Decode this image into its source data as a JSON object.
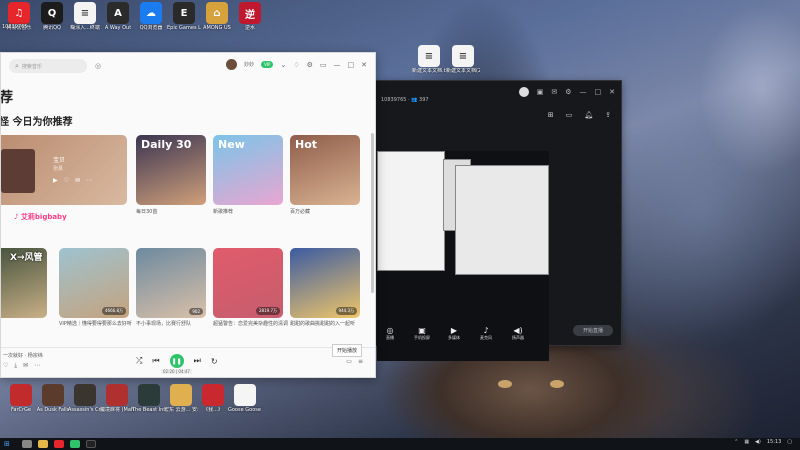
{
  "desktop": {
    "top_icons": [
      {
        "name": "netease-music",
        "label": "网易云音乐",
        "color": "#e6262a",
        "glyph": "♫"
      },
      {
        "name": "qq",
        "label": "腾讯QQ",
        "color": "#1c1c1c",
        "glyph": "Q"
      },
      {
        "name": "doc",
        "label": "糊涂入...终端",
        "color": "#f4f4f4",
        "glyph": "≡"
      },
      {
        "name": "a-way-out",
        "label": "A Way Out",
        "color": "#2b2b2b",
        "glyph": "A"
      },
      {
        "name": "qq-browser",
        "label": "QQ浏览器",
        "color": "#1b7cf0",
        "glyph": "☁"
      },
      {
        "name": "epic",
        "label": "Epic Games Launcher",
        "color": "#2a2a2a",
        "glyph": "E"
      },
      {
        "name": "among-us",
        "label": "AMONG US",
        "color": "#d6a23c",
        "glyph": "⌂"
      },
      {
        "name": "game-nz",
        "label": "逆水",
        "color": "#c0182e",
        "glyph": "逆"
      }
    ],
    "top_left_badge": "10839765",
    "file_icons": [
      {
        "label": "新建文本文档.txt"
      },
      {
        "label": "新建文本文档(2).txt"
      }
    ],
    "bottom_icons": [
      {
        "label": "FarCrGe",
        "color": "#c22b2b"
      },
      {
        "label": "As Dusk Falls",
        "color": "#5a3b2c"
      },
      {
        "label": "Assassin's Creed S...",
        "color": "#3b3530"
      },
      {
        "label": "魔境麻将 (Mahjong...",
        "color": "#b03030"
      },
      {
        "label": "The Beast Inside",
        "color": "#2a3b3a"
      },
      {
        "label": "宏东 云游... 安卓游戏...",
        "color": "#e0b050"
      },
      {
        "label": "《我...》",
        "color": "#c8282e"
      },
      {
        "label": "Goose Goose Duck",
        "color": "#f5f5f5"
      }
    ]
  },
  "music_window": {
    "search_placeholder": "搜索音乐",
    "username": "妙妙",
    "vip_label": "VIP",
    "heading": "荐",
    "subheading": "怪 今日为你推荐",
    "row1_cards": [
      {
        "caption": "",
        "title": "宝贝",
        "subtitle": "张悬",
        "bg": "linear-gradient(135deg,#b98a6e,#d8b9a0)"
      },
      {
        "caption": "每日30首",
        "big": "Daily 30",
        "bg": "linear-gradient(160deg,#3b3552,#d0a07a)"
      },
      {
        "caption": "新歌推荐",
        "big": "New",
        "bg": "linear-gradient(160deg,#7cc4e8,#e8a6d1)"
      },
      {
        "caption": "百万必藏",
        "big": "Hot",
        "bg": "linear-gradient(160deg,#8f5d4a,#d9b392)"
      }
    ],
    "row2_cards": [
      {
        "caption": "",
        "plays": "",
        "bg": "linear-gradient(160deg,#3c4c38,#c9b087)"
      },
      {
        "caption": "VIP精选｜懂得要得要那么去好听",
        "plays": "4666.8万",
        "bg": "linear-gradient(160deg,#9ec2cf,#c5a37e)"
      },
      {
        "caption": "不小事现场，比赛行舒队",
        "plays": "902",
        "bg": "linear-gradient(160deg,#6d8a9f,#d9c0a9)"
      },
      {
        "caption": "超猛警告：恋爱完美杂趣性的清调",
        "plays": "2819.7万",
        "bg": "linear-gradient(160deg,#e05c6b,#c65d6d)"
      },
      {
        "caption": "甜甜的歌曲挑甜甜的入一起听",
        "plays": "944.3万",
        "bg": "linear-gradient(160deg,#3b5ba1,#f0c66a)"
      }
    ],
    "overlay_tiktok": "艾莉bigbaby",
    "overlay_live": "X→风管",
    "player_tip": "开始播放",
    "player_time": "02:20 | 04:47",
    "now_playing": "一次就好 · 杨宗纬"
  },
  "dark_window": {
    "id_text": "10839765",
    "count": "397",
    "tools": [
      {
        "label": "直播",
        "icon": "◎"
      },
      {
        "label": "手机投屏",
        "icon": "▣"
      },
      {
        "label": "多媒体",
        "icon": "▶"
      },
      {
        "label": "麦克风",
        "icon": "♪"
      },
      {
        "label": "扬声器",
        "icon": "◀)"
      }
    ],
    "start_label": "开始直播"
  },
  "taskbar": {
    "time": "15:13",
    "date": "2023/"
  }
}
